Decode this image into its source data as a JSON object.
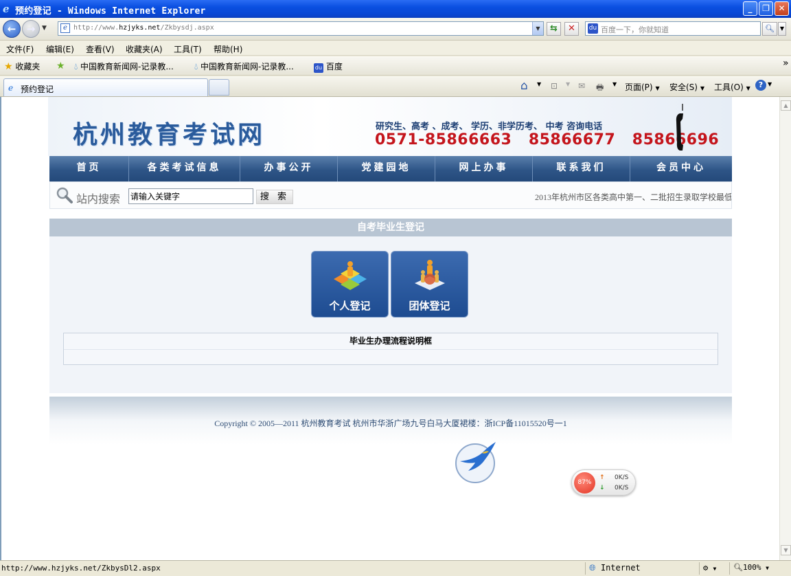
{
  "window": {
    "title": "预约登记 - Windows Internet Explorer",
    "buttons": {
      "minimize": "_",
      "restore": "❐",
      "close": "✕"
    }
  },
  "address_bar": {
    "url_prefix": "http://www.",
    "url_domain": "hzjyks.net",
    "url_path": "/Zkbysdj.aspx",
    "search_placeholder": "百度一下，你就知道"
  },
  "menu": [
    "文件(F)",
    "编辑(E)",
    "查看(V)",
    "收藏夹(A)",
    "工具(T)",
    "帮助(H)"
  ],
  "favorites_bar": {
    "favorites_label": "收藏夹",
    "links": [
      "中国教育新闻网-记录教...",
      "中国教育新闻网-记录教...",
      "百度"
    ]
  },
  "tab": {
    "label": "预约登记"
  },
  "command_bar": {
    "page": "页面(P)",
    "safety": "安全(S)",
    "tools": "工具(O)"
  },
  "site": {
    "logo": "杭州教育考试网",
    "contact_line": "研究生、高考 、成考、 学历、非学历考、 中考   咨询电话",
    "phones": [
      "0571-85866663",
      "85866677",
      "85866696"
    ],
    "nav": [
      "首页",
      "各类考试信息",
      "办事公开",
      "党建园地",
      "网上办事",
      "联系我们",
      "会员中心"
    ],
    "search": {
      "label": "站内搜索",
      "input_value": "请输入关键字",
      "button": "搜 索"
    },
    "marquee": "2013年杭州市区各类高中第一、二批招生录取学校最低",
    "section_title": "自考毕业生登记",
    "tiles": [
      "个人登记",
      "团体登记"
    ],
    "info_title": "毕业生办理流程说明框",
    "footer": "Copyright © 2005—2011 杭州教育考试  杭州市华浙广场九号白马大厦裙楼：浙ICP备11015520号一1"
  },
  "speed_widget": {
    "percent": "87%",
    "upload": "0K/S",
    "download": "0K/S"
  },
  "status_bar": {
    "link": "http://www.hzjyks.net/ZkbysDl2.aspx",
    "zone": "Internet",
    "zoom": "100%"
  }
}
